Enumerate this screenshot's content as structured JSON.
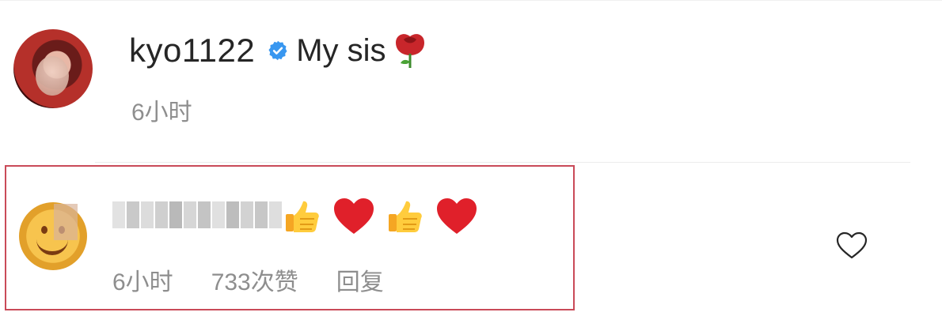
{
  "post": {
    "username": "kyo1122",
    "caption": "My sis",
    "time": "6小时"
  },
  "comment": {
    "time": "6小时",
    "likes": "733次赞",
    "reply": "回复"
  },
  "colors": {
    "text": "#262626",
    "muted": "#8e8e8e",
    "verified": "#3897f0",
    "highlight_border": "#c94a58"
  },
  "icons": {
    "verified": "verified-badge-icon",
    "rose": "rose-emoji-icon",
    "thumbs_up": "thumbs-up-emoji-icon",
    "heart_red": "red-heart-emoji-icon",
    "like": "heart-outline-icon"
  }
}
